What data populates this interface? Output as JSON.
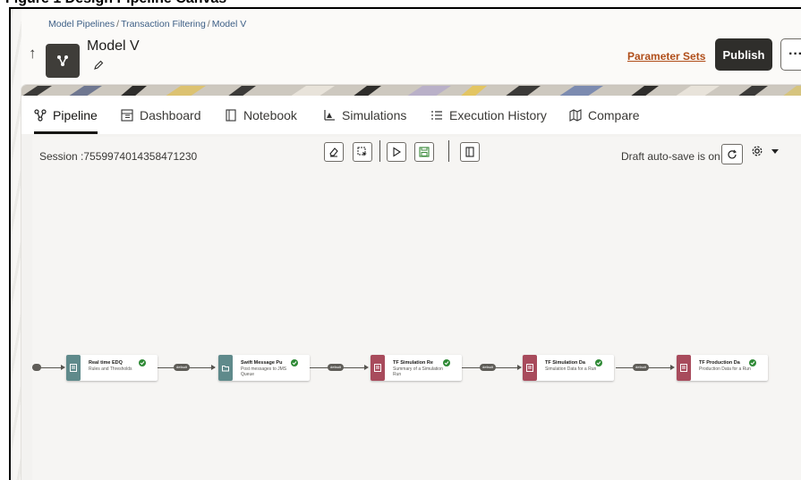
{
  "header_caption": "Figure 1  Design Pipeline Canvas",
  "breadcrumb": {
    "items": [
      "Model Pipelines",
      "Transaction Filtering",
      "Model V"
    ]
  },
  "model": {
    "title": "Model V",
    "icon": "pipeline-icon"
  },
  "actions": {
    "parameter_sets": "Parameter Sets",
    "publish": "Publish",
    "more": "···"
  },
  "tabs": [
    {
      "label": "Pipeline",
      "icon": "pipeline-icon",
      "active": true
    },
    {
      "label": "Dashboard",
      "icon": "dashboard-icon",
      "active": false
    },
    {
      "label": "Notebook",
      "icon": "notebook-icon",
      "active": false
    },
    {
      "label": "Simulations",
      "icon": "chart-icon",
      "active": false
    },
    {
      "label": "Execution History",
      "icon": "list-icon",
      "active": false
    },
    {
      "label": "Compare",
      "icon": "map-icon",
      "active": false
    }
  ],
  "canvas": {
    "session": "Session :7559974014358471230",
    "autosave": "Draft auto-save is on",
    "toolbar": [
      "eraser-icon",
      "select-icon",
      "run-icon",
      "save-icon",
      "book-icon"
    ]
  },
  "pipeline": {
    "edge_label": "default",
    "nodes": [
      {
        "title": "Real time EDQ",
        "subtitle": "Rules and Thresholds",
        "icon_color": "#5f8a8b",
        "status": "complete"
      },
      {
        "title": "Swift Message Pu",
        "subtitle": "Post messages to JMS Queue",
        "icon_color": "#5f8a8b",
        "status": "complete"
      },
      {
        "title": "TF Simulation Re",
        "subtitle": "Summary of a Simulation Run",
        "icon_color": "#a84b5c",
        "status": "complete"
      },
      {
        "title": "TF Simulation Da",
        "subtitle": "Simulation Data for a Run",
        "icon_color": "#a84b5c",
        "status": "complete"
      },
      {
        "title": "TF Production Da",
        "subtitle": "Production Data for a Run",
        "icon_color": "#a84b5c",
        "status": "complete"
      }
    ]
  },
  "colors": {
    "accent_link": "#b04e1a",
    "primary_button": "#2f2e2b",
    "check": "#2f8a36",
    "breadcrumb": "#3d5f86"
  }
}
